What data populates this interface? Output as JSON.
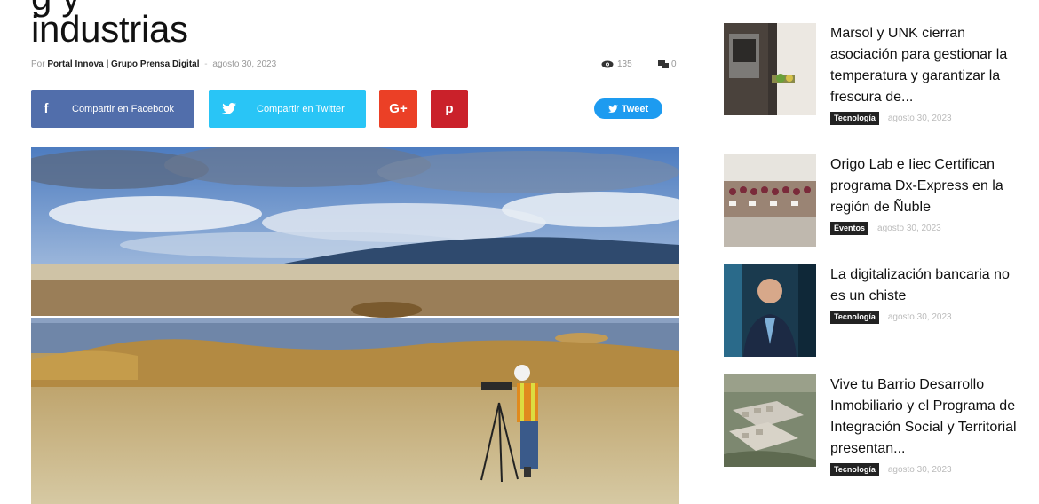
{
  "article": {
    "title_line1": "g                                      y",
    "title_line2": "industrias",
    "byline_prefix": "Por",
    "author": "Portal Innova | Grupo Prensa Digital",
    "separator": "-",
    "date": "agosto 30, 2023",
    "views": "135",
    "comments": "0"
  },
  "share": {
    "facebook_icon": "f",
    "facebook_label": "Compartir en Facebook",
    "twitter_label": "Compartir en Twitter",
    "googleplus_icon": "G+",
    "pinterest_icon": "p",
    "tweet_label": "Tweet"
  },
  "sidebar": {
    "items": [
      {
        "title": "Marsol y UNK cierran asociación para gestionar la temperatura y garantizar la frescura de...",
        "category": "Tecnología",
        "date": "agosto 30, 2023"
      },
      {
        "title": "Origo Lab e Iiec Certifican programa Dx-Express en la región de Ñuble",
        "category": "Eventos",
        "date": "agosto 30, 2023"
      },
      {
        "title": "La digitalización bancaria no es un chiste",
        "category": "Tecnología",
        "date": "agosto 30, 2023"
      },
      {
        "title": "Vive tu Barrio Desarrollo Inmobiliario y el Programa de Integración Social y Territorial presentan...",
        "category": "Tecnología",
        "date": "agosto 30, 2023"
      }
    ]
  },
  "colors": {
    "facebook": "#516eab",
    "twitter": "#29c5f6",
    "googleplus": "#eb4026",
    "pinterest": "#ca212a",
    "tweet": "#1d9bf0",
    "category_bg": "#222222"
  },
  "icons": {
    "views": "eye-icon",
    "comments": "comment-icon",
    "twitter": "twitter-bird-icon"
  }
}
